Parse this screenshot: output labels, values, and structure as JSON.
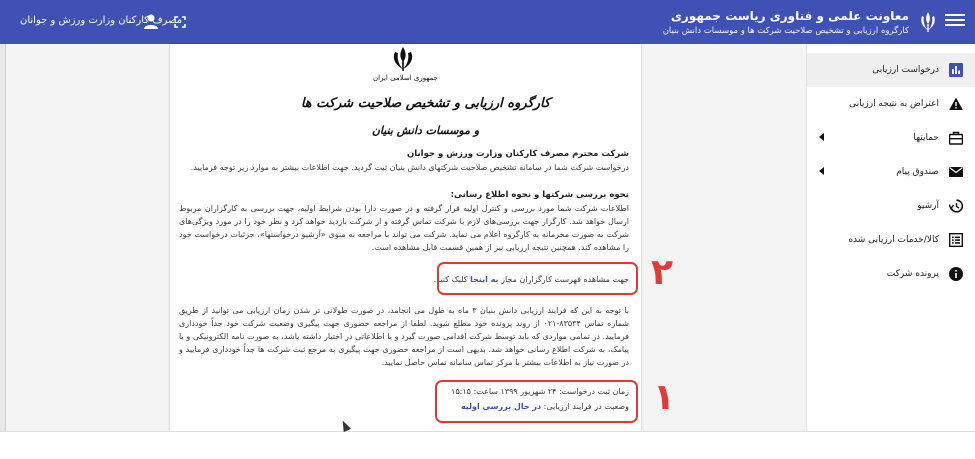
{
  "topbar": {
    "title": "معاونت علمی و فناوری ریاست جمهوری",
    "subtitle": "کارگروه ارزیابی و تشخیص صلاحیت شرکت ها و موسسات دانش بنیان",
    "user_name": "مصرف کارکنان وزارت ورزش و جوانان",
    "menu_icon": "hamburger-menu-icon",
    "user_icon": "person-icon",
    "fullscreen_icon": "fullscreen-icon"
  },
  "drawer": {
    "items": [
      {
        "label": "درخواست ارزیابی",
        "icon": "bar-chart-icon",
        "active": true,
        "expandable": false
      },
      {
        "label": "اعتراض به نتیجه ارزیابی",
        "icon": "warning-icon",
        "active": false,
        "expandable": false
      },
      {
        "label": "حمایتها",
        "icon": "briefcase-icon",
        "active": false,
        "expandable": true
      },
      {
        "label": "صندوق پیام",
        "icon": "envelope-icon",
        "active": false,
        "expandable": true
      },
      {
        "label": "آرشیو",
        "icon": "history-icon",
        "active": false,
        "expandable": false
      },
      {
        "label": "کالا/خدمات ارزیابی شده",
        "icon": "list-icon",
        "active": false,
        "expandable": false
      },
      {
        "label": "پرونده شرکت",
        "icon": "info-icon",
        "active": false,
        "expandable": false
      }
    ]
  },
  "document": {
    "header_line1": "جمهوری اسلامی ایران",
    "header_line2": "کارگروه ارزیابی و تشخیص صلاحیت شرکت ها",
    "header_line3": "و موسسات دانش بنیان",
    "greeting": "شرکت محترم مصرف کارکنان وزارت ورزش و جوانان",
    "intro": "درخواست شرکت شما در سامانه تشخیص صلاحیت شرکتهای دانش بنیان ثبت گردید. جهت اطلاعات بیشتر به موارد زیر توجه فرمایید.",
    "section_title": "نحوه بررسی شرکتها و نحوه اطلاع رسانی:",
    "section_body": "اطلاعات شرکت شما مورد بررسی و کنترل اولیه قرار گرفته و در صورت دارا بودن شرایط اولیه، جهت بررسی به کارگزاران مربوط ارسال خواهد شد. کارگزار جهت بررسی‌های لازم با شرکت تماس گرفته و از شرکت بازدید خواهد کرد و نظر خود را در مورد ویژگی‌های شرکت به صورت محرمانه به کارگروه اعلام می نماید. شرکت می تواند با مراجعه به منوی «آرشیو درخواستها»، جزئیات درخواست خود را مشاهده کند. همچنین نتیجه ارزیابی نیز از همین قسمت قابل مشاهده است.",
    "list_text": "جهت مشاهده فهرست کارگزاران مجاز",
    "list_link": "به اینجا",
    "list_suffix": "کلیک کنید.",
    "extra_body": "با توجه به این که فرایند ارزیابی دانش بنیان ۳ ماه به طول می انجامد، در صورت طولانی تر شدن زمان ارزیابی می توانید از طریق شماره تماس ۸۳۵۳۴-۰۲۱ از روند پرونده خود مطلع شوید. لطفا از مراجعه حضوری جهت پیگیری وضعیت شرکت خود جداً خودداری فرمایید. در تمامی مواردی که باید توسط شرکت اقدامی صورت گیرد و یا اطلاعاتی در اختیار داشته باشد، به صورت نامه الکترونیکی و یا پیامک، به شرکت اطلاع رسانی خواهد شد. بدیهی است از مراجعه حضوری جهت پیگیری به مرجع ثبت شرکت ها جداً خودداری فرمایید و در صورت نیاز به اطلاعات بیشتر با مرکز تماس سامانه تماس حاصل نمایید.",
    "time_line": "زمان ثبت درخواست: ۲۴ شهریور ۱۳۹۹ ساعت: ۱۵:۱۵",
    "status_label": "وضعیت در فرایند ارزیابی:",
    "status_value": "در حال بررسی اولیه"
  },
  "annotations": {
    "marker_1": "۱",
    "marker_2": "۲",
    "color": "#e53935"
  },
  "colors": {
    "primary": "#3f51b5",
    "link": "#3f51b5",
    "annotation": "#e53935"
  }
}
